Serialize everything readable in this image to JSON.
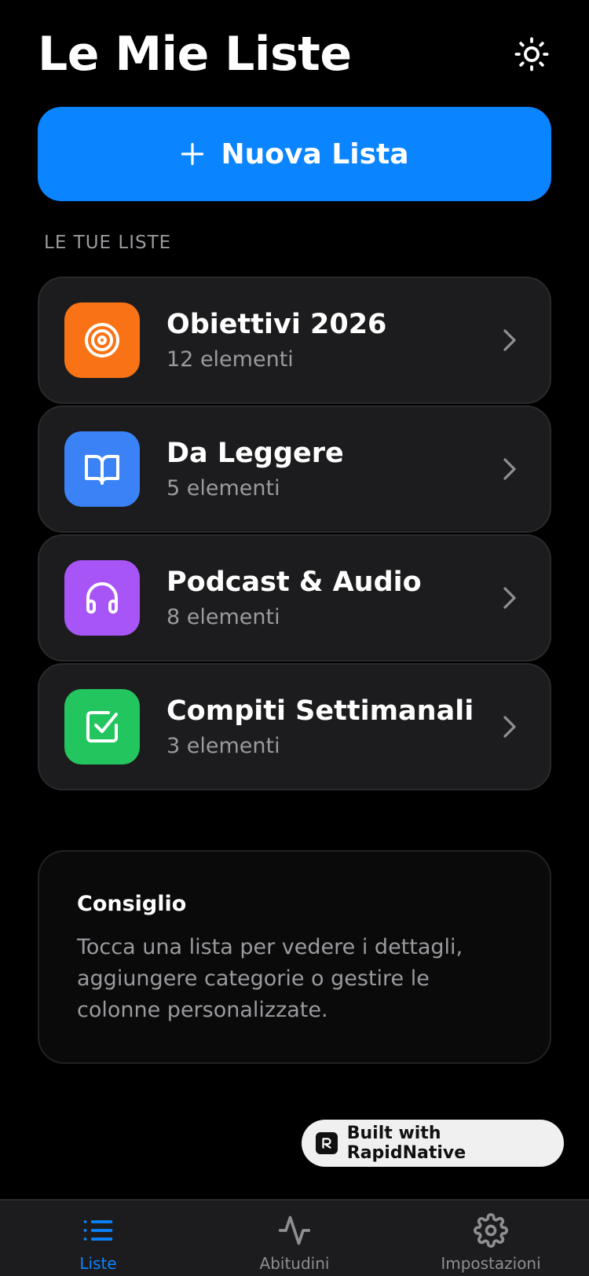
{
  "header": {
    "title": "Le Mie Liste",
    "theme_icon": "sun-icon"
  },
  "new_list_button": {
    "icon": "plus-icon",
    "label": "Nuova Lista"
  },
  "section_label": "LE TUE LISTE",
  "lists": [
    {
      "title": "Obiettivi 2026",
      "count": "12 elementi",
      "icon": "target-icon",
      "color": "#F97316"
    },
    {
      "title": "Da Leggere",
      "count": "5 elementi",
      "icon": "book-open-icon",
      "color": "#3B82F6"
    },
    {
      "title": "Podcast & Audio",
      "count": "8 elementi",
      "icon": "headphones-icon",
      "color": "#A855F7"
    },
    {
      "title": "Compiti Settimanali",
      "count": "3 elementi",
      "icon": "check-square-icon",
      "color": "#22C55E"
    }
  ],
  "tip": {
    "title": "Consiglio",
    "body": "Tocca una lista per vedere i dettagli, aggiungere categorie o gestire le colonne personalizzate."
  },
  "badge": {
    "label": "Built with RapidNative"
  },
  "tabs": [
    {
      "label": "Liste",
      "icon": "list-icon",
      "active": true
    },
    {
      "label": "Abitudini",
      "icon": "activity-icon",
      "active": false
    },
    {
      "label": "Impostazioni",
      "icon": "gear-icon",
      "active": false
    }
  ],
  "colors": {
    "accent": "#0A84FF",
    "background": "#000000",
    "card": "#1C1C1E",
    "muted_text": "#9A9A9F"
  }
}
